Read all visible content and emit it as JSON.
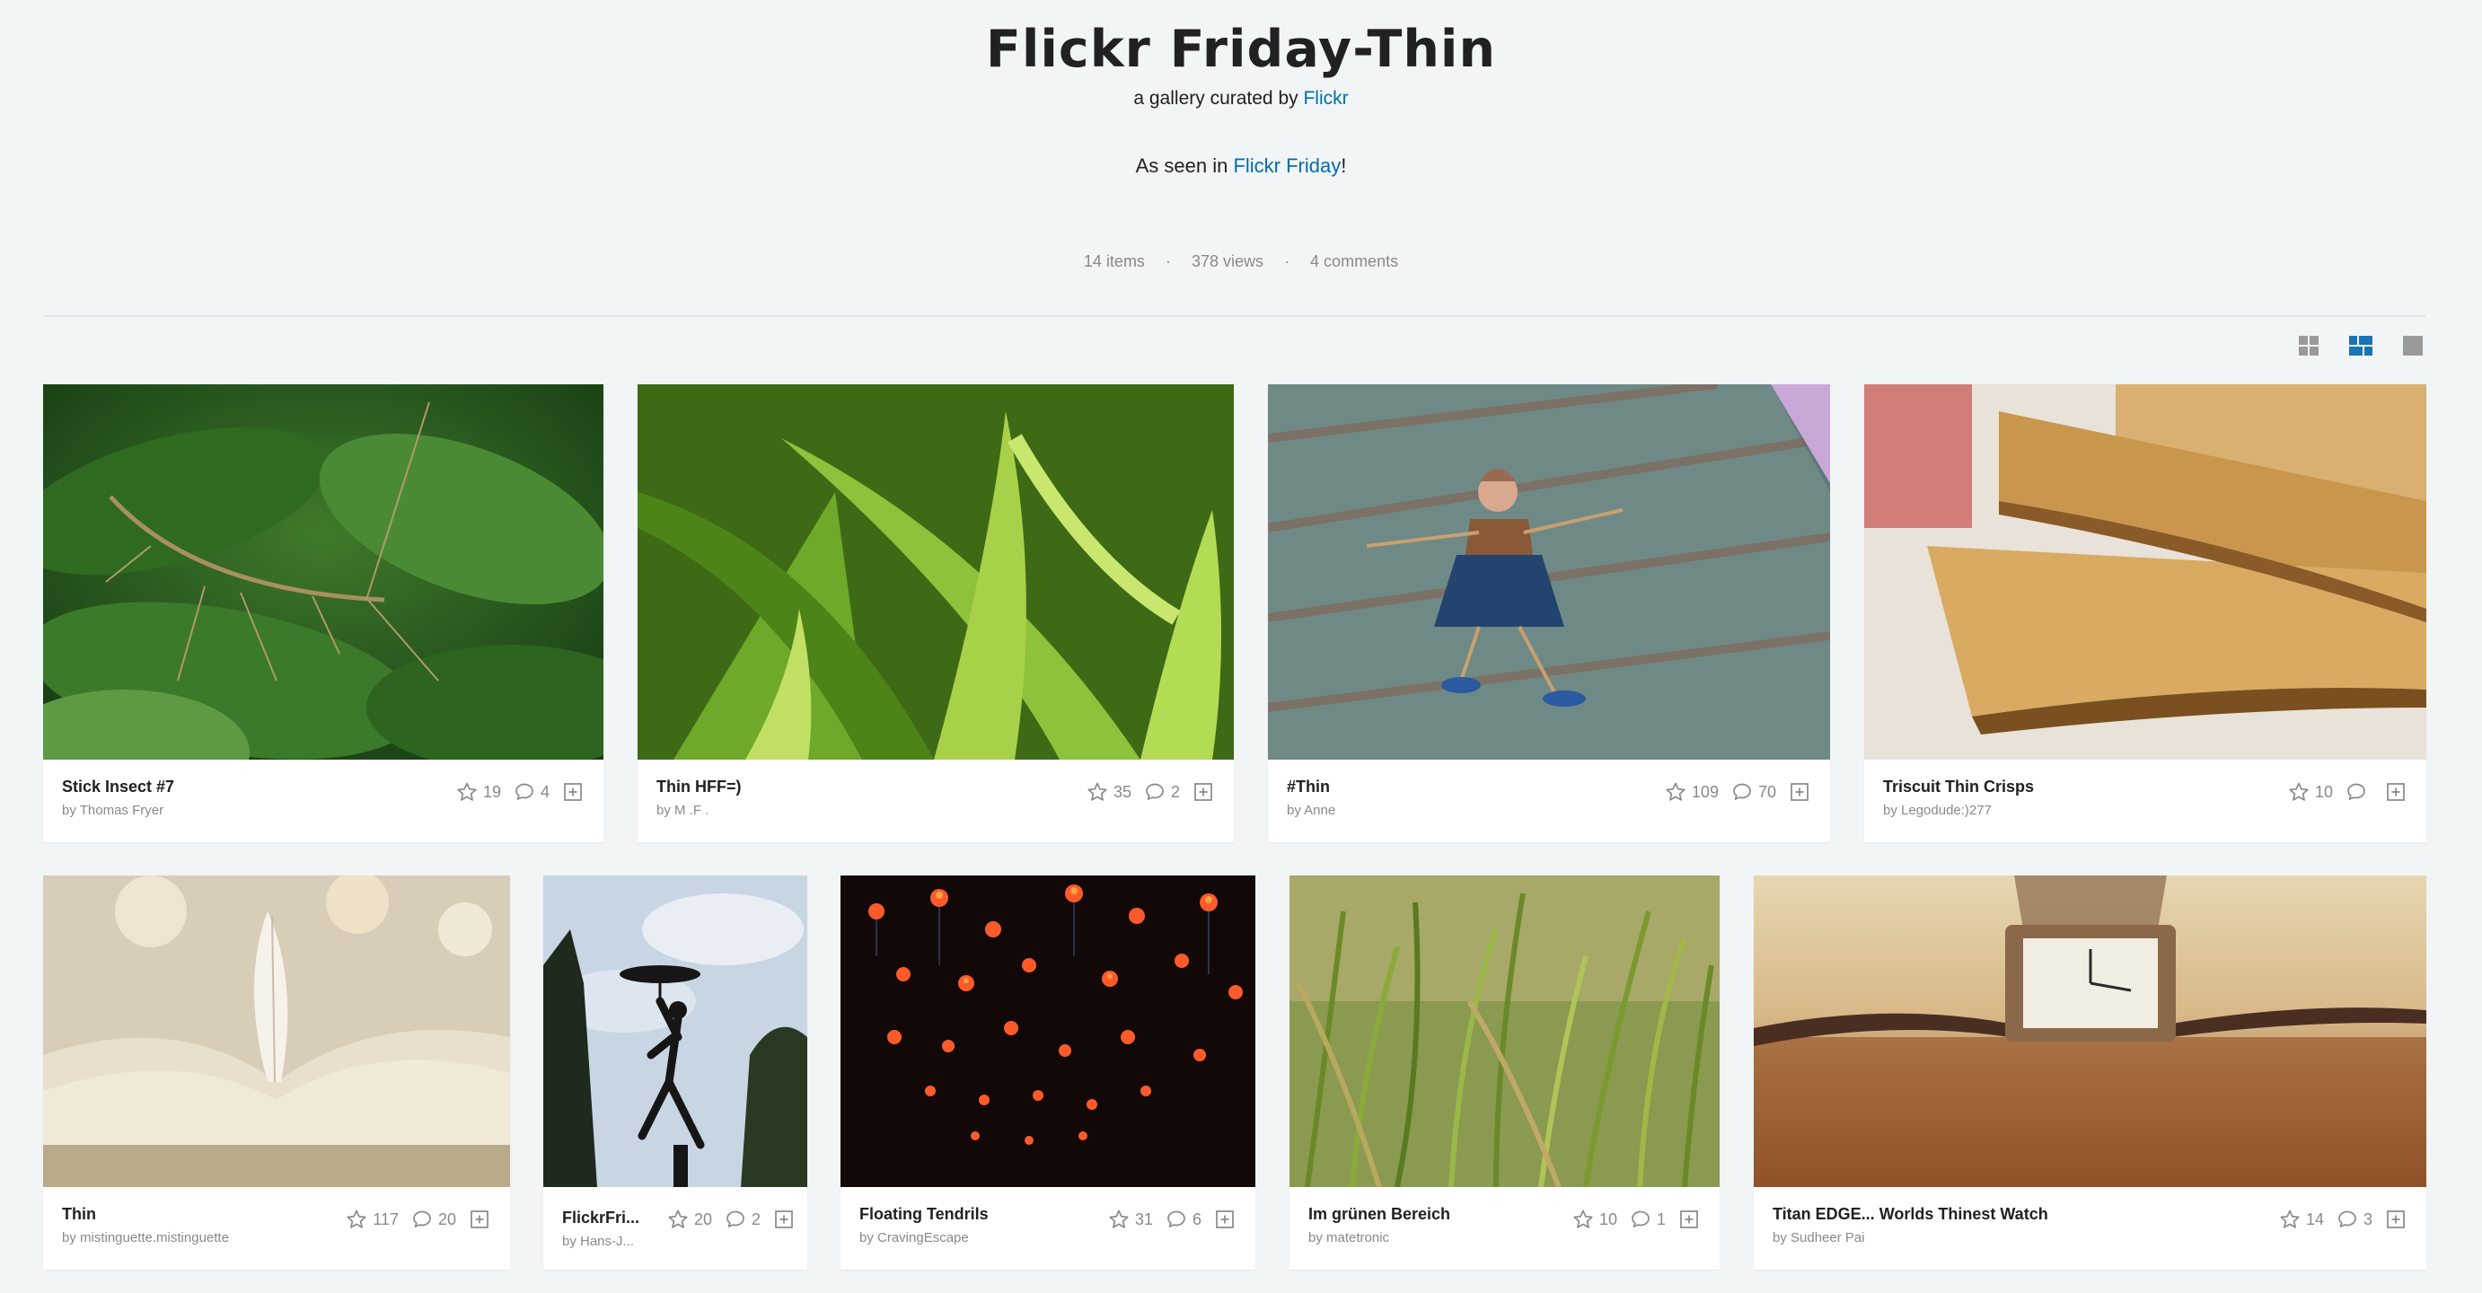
{
  "header": {
    "title": "Flickr Friday-Thin",
    "curated_prefix": "a gallery curated by",
    "curator": "Flickr",
    "desc_prefix": "As seen in",
    "desc_link": "Flickr Friday",
    "desc_suffix": "!"
  },
  "stats": {
    "items": "14 items",
    "views": "378 views",
    "comments": "4 comments"
  },
  "layout_toggles": [
    "grid-small",
    "grid-justified",
    "grid-large"
  ],
  "colors": {
    "link": "#006dac",
    "active_toggle": "#1a73b5",
    "inactive_toggle": "#9a9a9a"
  },
  "photos": [
    {
      "title": "Stick Insect #7",
      "by": "by Thomas Fryer",
      "faves": "19",
      "comments": "4"
    },
    {
      "title": "Thin HFF=)",
      "by": "by M .F .",
      "faves": "35",
      "comments": "2"
    },
    {
      "title": "#Thin",
      "by": "by Anne",
      "faves": "109",
      "comments": "70"
    },
    {
      "title": "Triscuit Thin Crisps",
      "by": "by Legodude:)277",
      "faves": "10",
      "comments": ""
    },
    {
      "title": "Thin",
      "by": "by mistinguette.mistinguette",
      "faves": "117",
      "comments": "20"
    },
    {
      "title": "FlickrFri...",
      "by": "by Hans-J...",
      "faves": "20",
      "comments": "2"
    },
    {
      "title": "Floating Tendrils",
      "by": "by CravingEscape",
      "faves": "31",
      "comments": "6"
    },
    {
      "title": "Im grünen Bereich",
      "by": "by matetronic",
      "faves": "10",
      "comments": "1"
    },
    {
      "title": "Titan EDGE... Worlds Thinest Watch",
      "by": "by Sudheer Pai",
      "faves": "14",
      "comments": "3"
    }
  ]
}
